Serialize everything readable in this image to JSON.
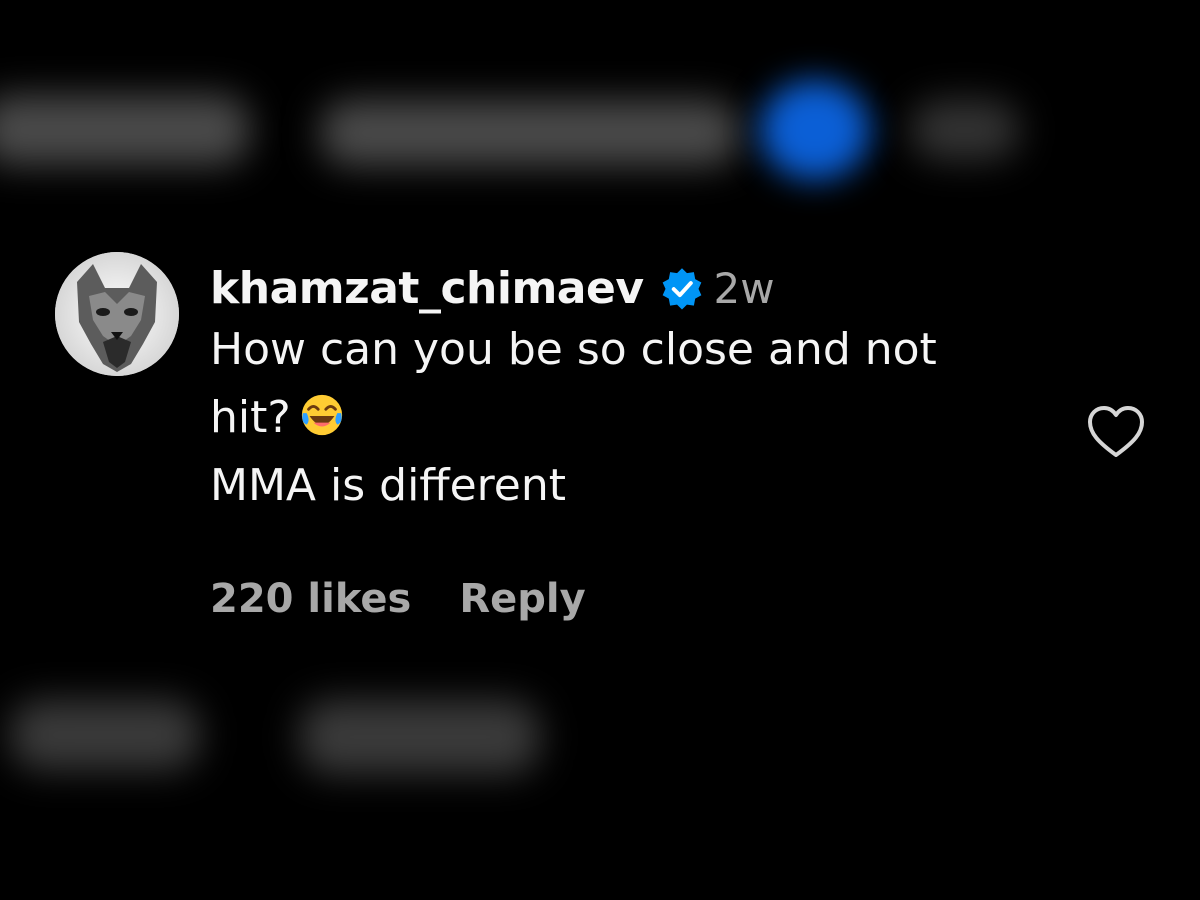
{
  "comment": {
    "username": "khamzat_chimaev",
    "verified": true,
    "timestamp": "2w",
    "lines": [
      "How can you be so close and not",
      "hit?",
      "MMA is different"
    ],
    "emoji_name": "face-with-tears-of-joy",
    "likes_label": "220 likes",
    "reply_label": "Reply"
  },
  "icons": {
    "avatar": "wolf-avatar",
    "verified": "verified-badge-icon",
    "like": "heart-outline-icon"
  },
  "colors": {
    "background": "#000000",
    "text": "#f5f5f5",
    "muted": "#a8a8a8",
    "verified_blue": "#0095f6"
  }
}
